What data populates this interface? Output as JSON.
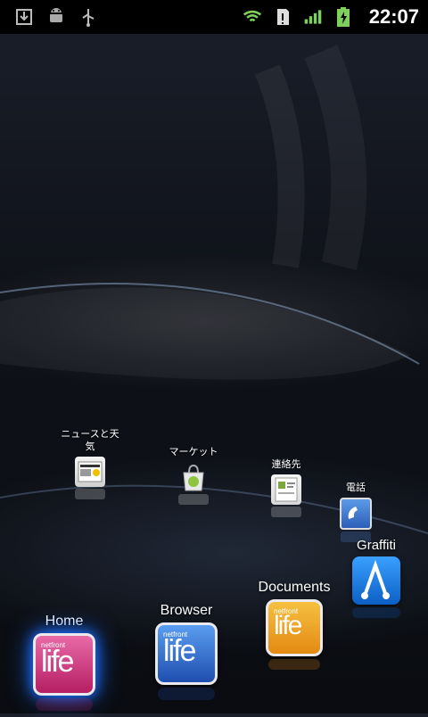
{
  "status_bar": {
    "time": "22:07",
    "left_icons": [
      "download-icon",
      "android-icon",
      "usb-icon"
    ],
    "right_icons": [
      "wifi-icon",
      "sd-card-icon",
      "signal-icon",
      "battery-charging-icon"
    ]
  },
  "apps_small": [
    {
      "label": "ニュースと天気",
      "icon": "newspaper-icon"
    },
    {
      "label": "マーケット",
      "icon": "market-icon"
    },
    {
      "label": "連絡先",
      "icon": "contacts-icon"
    },
    {
      "label": "電話",
      "icon": "phone-icon"
    }
  ],
  "apps_large": [
    {
      "label": "Home",
      "brand": "netfront",
      "icon_text": "life",
      "color": "#d62d7b"
    },
    {
      "label": "Browser",
      "brand": "netfront",
      "icon_text": "life",
      "color": "#2f6fd4"
    },
    {
      "label": "Documents",
      "brand": "netfront",
      "icon_text": "life",
      "color": "#f0a21a"
    },
    {
      "label": "Graffiti",
      "icon": "graffiti-icon",
      "color": "#1e86e8"
    }
  ],
  "colors": {
    "home_glow": "#1d6dff",
    "graffiti_bg": "#1a7ff0"
  }
}
